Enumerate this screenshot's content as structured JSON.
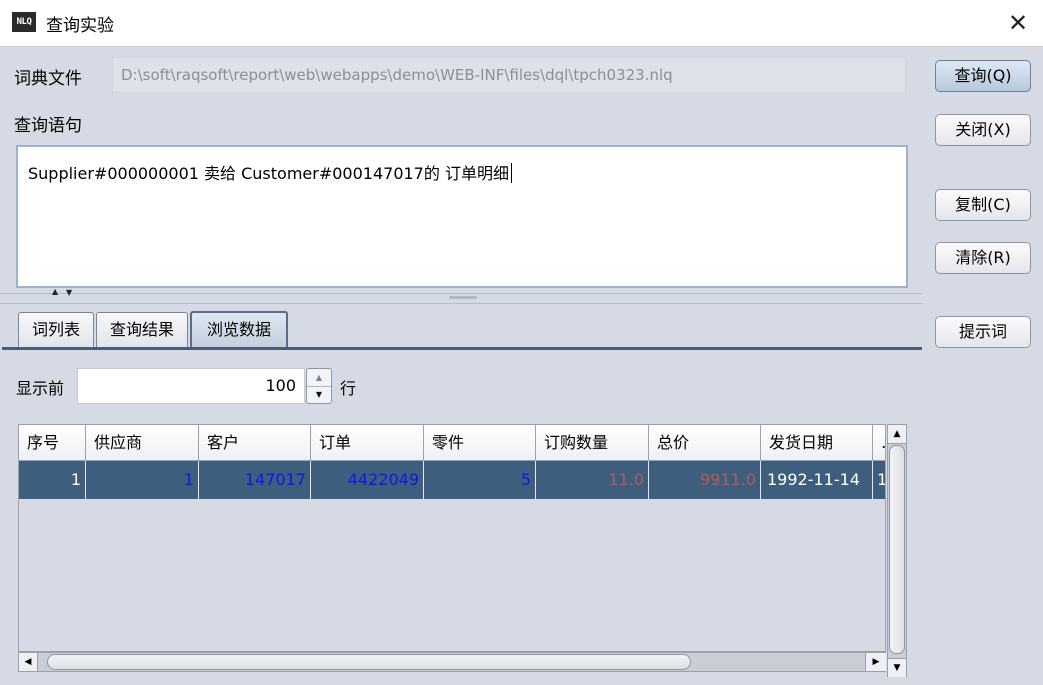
{
  "window": {
    "icon_text": "NLQ",
    "title": "查询实验",
    "close_glyph": "✕"
  },
  "form": {
    "dict_label": "词典文件",
    "dict_path": "D:\\soft\\raqsoft\\report\\web\\webapps\\demo\\WEB-INF\\files\\dql\\tpch0323.nlq",
    "query_label": "查询语句",
    "query_text": "Supplier#000000001 卖给 Customer#000147017的 订单明细"
  },
  "buttons": {
    "query": "查询(Q)",
    "close": "关闭(X)",
    "copy": "复制(C)",
    "clear": "清除(R)",
    "hint": "提示词"
  },
  "tabs": [
    "词列表",
    "查询结果",
    "浏览数据"
  ],
  "active_tab": "浏览数据",
  "browse": {
    "show_label": "显示前",
    "rows_value": "100",
    "rows_unit": "行"
  },
  "table": {
    "columns": [
      "序号",
      "供应商",
      "客户",
      "订单",
      "零件",
      "订购数量",
      "总价",
      "发货日期",
      "…"
    ],
    "rows": [
      [
        "1",
        "1",
        "147017",
        "4422049",
        "5",
        "11.0",
        "9911.0",
        "1992-11-14",
        "1"
      ]
    ]
  },
  "colors": {
    "selected_row_bg": "#3d5f7d",
    "link_value": "#1515e8",
    "numeric_value": "#b25a5a",
    "tab_underline": "#4b5c76"
  },
  "icons": {
    "close": "close-icon",
    "spinner_up": "triangle-up-icon",
    "spinner_down": "triangle-down-icon",
    "scroll_up": "arrow-up-icon",
    "scroll_down": "arrow-down-icon",
    "scroll_left": "arrow-left-icon",
    "scroll_right": "arrow-right-icon"
  }
}
